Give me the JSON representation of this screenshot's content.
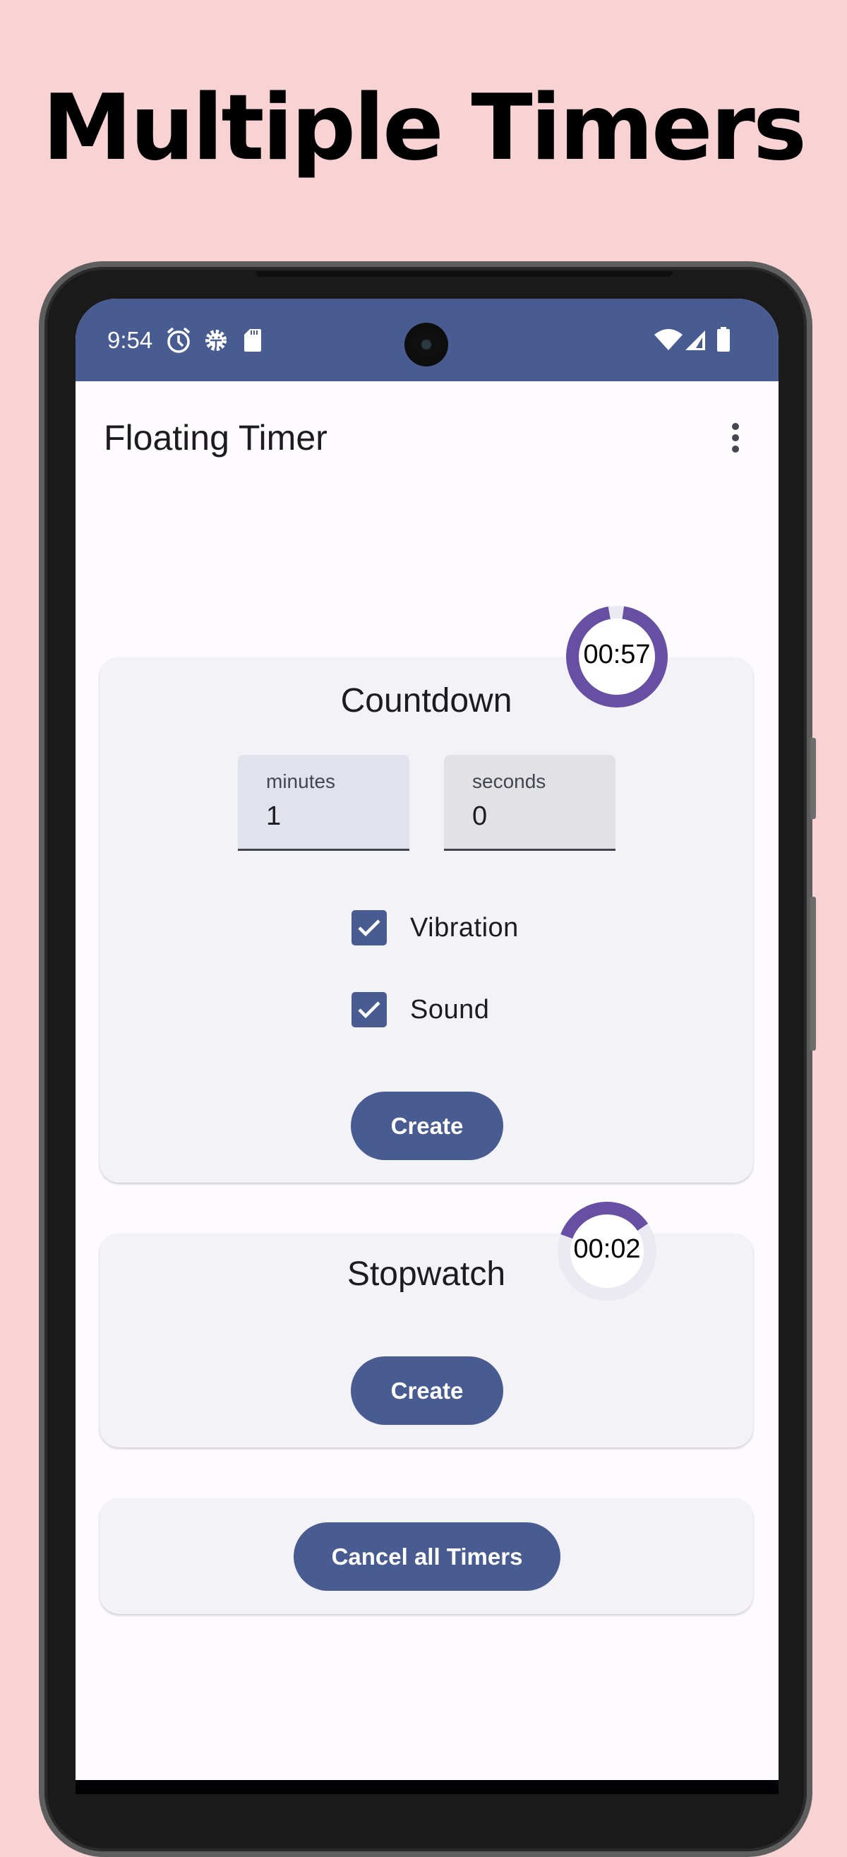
{
  "promo": {
    "headline": "Multiple Timers"
  },
  "status_bar": {
    "time": "9:54",
    "left_icons": [
      "alarm-icon",
      "android-gear-icon",
      "sd-card-icon"
    ],
    "right_icons": [
      "wifi-icon",
      "cell-signal-icon",
      "battery-icon"
    ]
  },
  "app_bar": {
    "title": "Floating Timer",
    "menu_icon": "more-vert-icon"
  },
  "countdown": {
    "title": "Countdown",
    "minutes": {
      "label": "minutes",
      "value": "1"
    },
    "seconds": {
      "label": "seconds",
      "value": "0"
    },
    "options": [
      {
        "label": "Vibration",
        "checked": true
      },
      {
        "label": "Sound",
        "checked": true
      }
    ],
    "create_label": "Create",
    "floating_timer": {
      "display": "00:57",
      "remaining_fraction": 0.95
    }
  },
  "stopwatch": {
    "title": "Stopwatch",
    "create_label": "Create",
    "floating_timer": {
      "display": "00:02",
      "progress_fraction": 0.35
    }
  },
  "cancel": {
    "label": "Cancel all Timers"
  },
  "colors": {
    "background": "#f9d3d3",
    "primary": "#485c92",
    "ring": "#6750a4",
    "ring_track": "#ebe9f2",
    "card": "#f3f2f7",
    "screen": "#fefbfe"
  }
}
